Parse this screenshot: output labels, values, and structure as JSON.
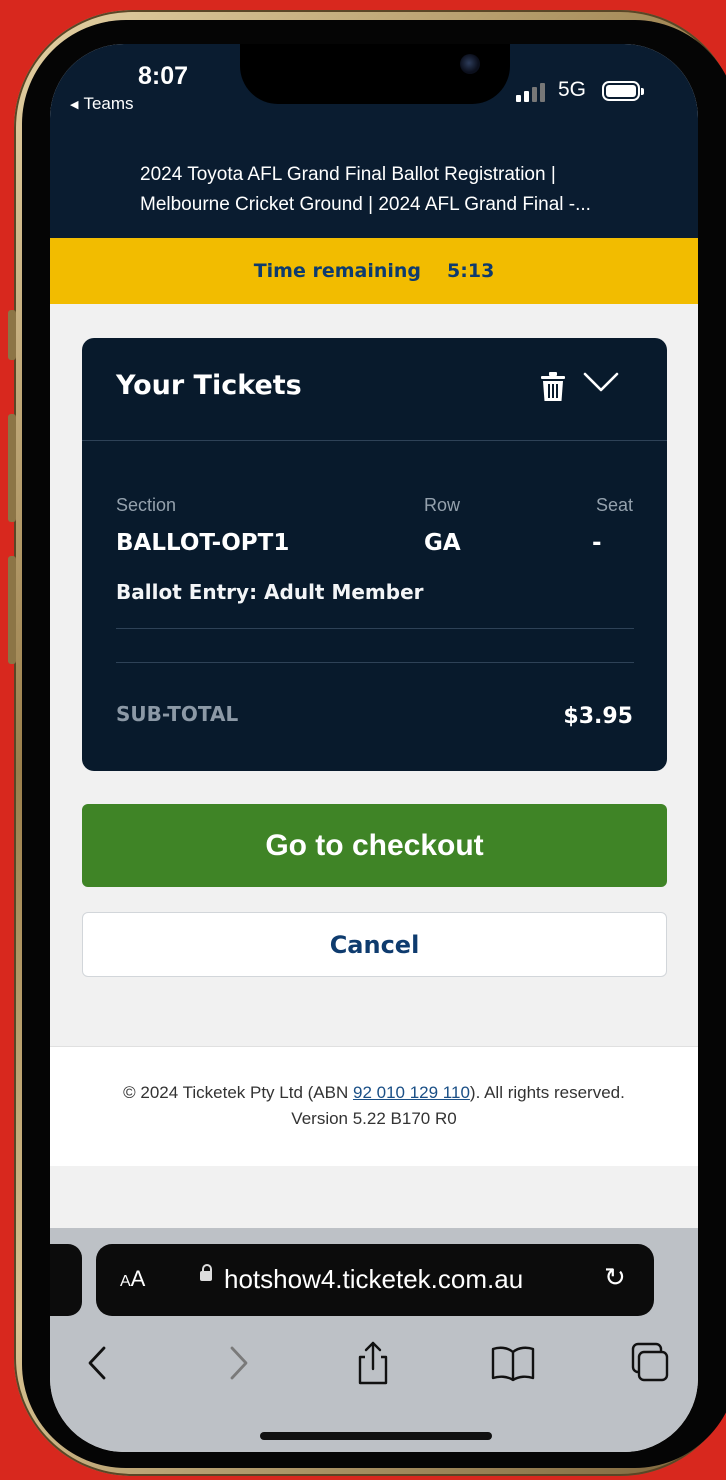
{
  "status_bar": {
    "time": "8:07",
    "back_app": "Teams",
    "network": "5G"
  },
  "header": {
    "title_line1": "2024 Toyota AFL Grand Final Ballot Registration |",
    "title_line2": "Melbourne Cricket Ground | 2024 AFL Grand Final -..."
  },
  "timer": {
    "label": "Time remaining",
    "value": "5:13"
  },
  "tickets": {
    "title": "Your Tickets",
    "section_label": "Section",
    "section_value": "BALLOT-OPT1",
    "row_label": "Row",
    "row_value": "GA",
    "seat_label": "Seat",
    "seat_value": "-",
    "entry": "Ballot Entry: Adult Member",
    "subtotal_label": "SUB-TOTAL",
    "subtotal_value": "$3.95"
  },
  "actions": {
    "checkout": "Go to checkout",
    "cancel": "Cancel"
  },
  "footer": {
    "copyright_pre": "© 2024 Ticketek Pty Ltd (ABN ",
    "abn": "92 010 129 110",
    "copyright_post": "). All rights reserved.",
    "version": "Version 5.22 B170 R0"
  },
  "browser": {
    "text_size_small": "A",
    "text_size_large": "A",
    "url": "hotshow4.ticketek.com.au"
  },
  "colors": {
    "navy": "#0a1c30",
    "timer_yellow": "#f2bc00",
    "checkout_green": "#3f8426",
    "link_blue": "#0e3b6e"
  }
}
